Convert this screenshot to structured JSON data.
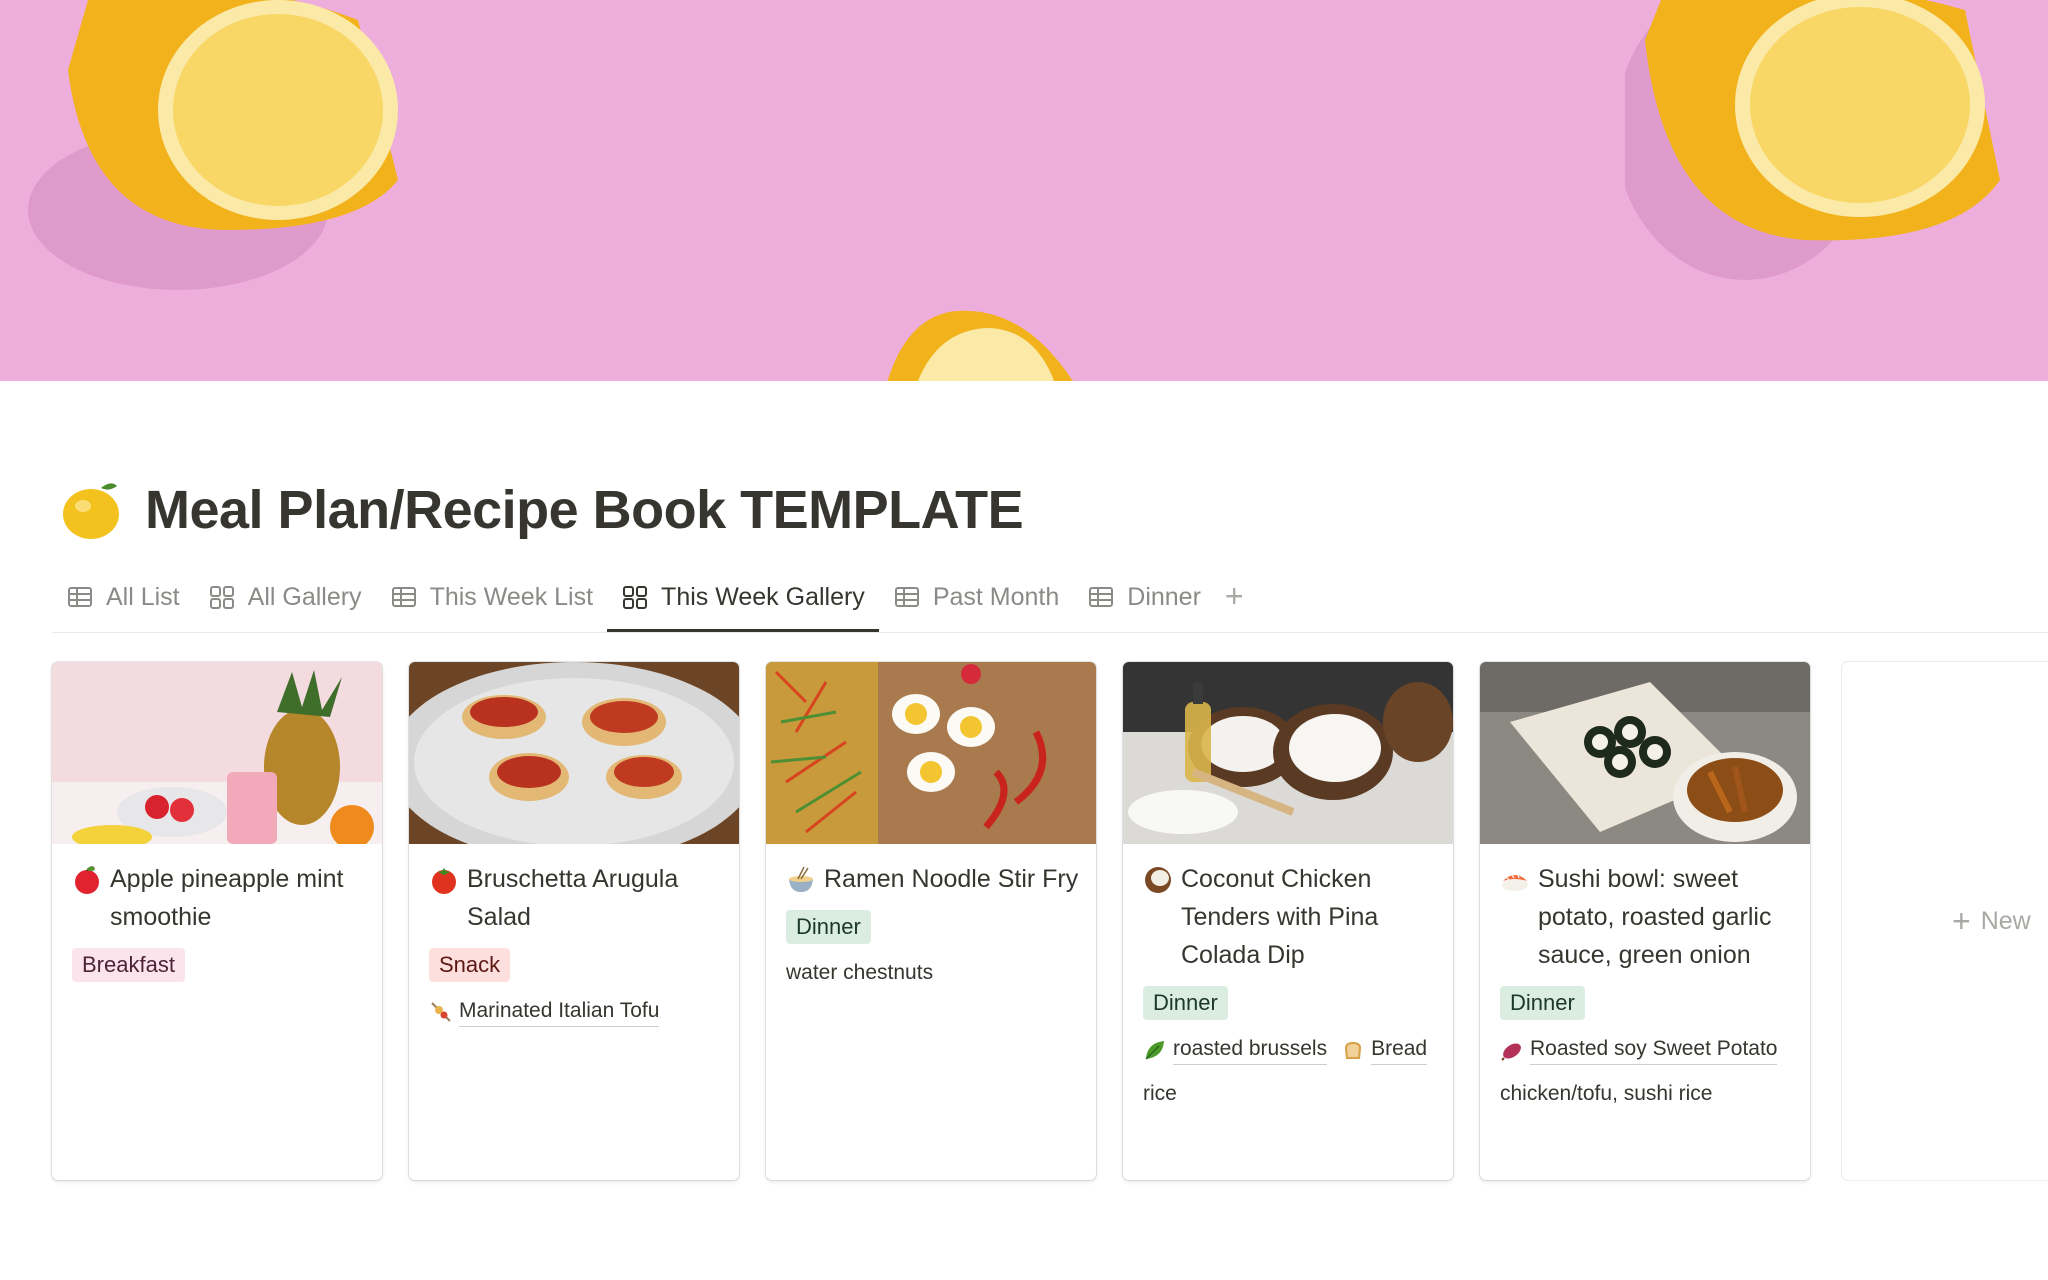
{
  "page": {
    "title": "Meal Plan/Recipe Book TEMPLATE",
    "icon": "lemon-icon",
    "cover_colors": {
      "background": "#eeaedc",
      "lemon": "#f4b91f"
    }
  },
  "tabs": [
    {
      "label": "All List",
      "icon": "table-icon",
      "active": false
    },
    {
      "label": "All Gallery",
      "icon": "gallery-icon",
      "active": false
    },
    {
      "label": "This Week List",
      "icon": "table-icon",
      "active": false
    },
    {
      "label": "This Week Gallery",
      "icon": "gallery-icon",
      "active": true
    },
    {
      "label": "Past Month",
      "icon": "table-icon",
      "active": false
    },
    {
      "label": "Dinner",
      "icon": "table-icon",
      "active": false
    }
  ],
  "tab_add_label": "+",
  "cards": [
    {
      "title": "Apple pineapple mint smoothie",
      "emoji": "apple-icon",
      "tag": "Breakfast",
      "tag_color": "#fbe4ec"
    },
    {
      "title": "Bruschetta Arugula Salad",
      "emoji": "tomato-icon",
      "tag": "Snack",
      "tag_color": "#fde0dd",
      "relations": [
        "Marinated Italian Tofu"
      ]
    },
    {
      "title": "Ramen Noodle Stir Fry",
      "emoji": "noodle-bowl-icon",
      "tag": "Dinner",
      "tag_color": "#dbede0",
      "text": "water chestnuts"
    },
    {
      "title": "Coconut Chicken Tenders with Pina Colada Dip",
      "emoji": "coconut-icon",
      "tag": "Dinner",
      "tag_color": "#dbede0",
      "relations": [
        "roasted brussels",
        "Bread"
      ],
      "text": "rice"
    },
    {
      "title": "Sushi bowl: sweet potato, roasted garlic sauce, green onion",
      "emoji": "sushi-icon",
      "tag": "Dinner",
      "tag_color": "#dbede0",
      "relations": [
        "Roasted soy Sweet Potato"
      ],
      "text": "chicken/tofu, sushi rice"
    }
  ],
  "new_label": "New"
}
